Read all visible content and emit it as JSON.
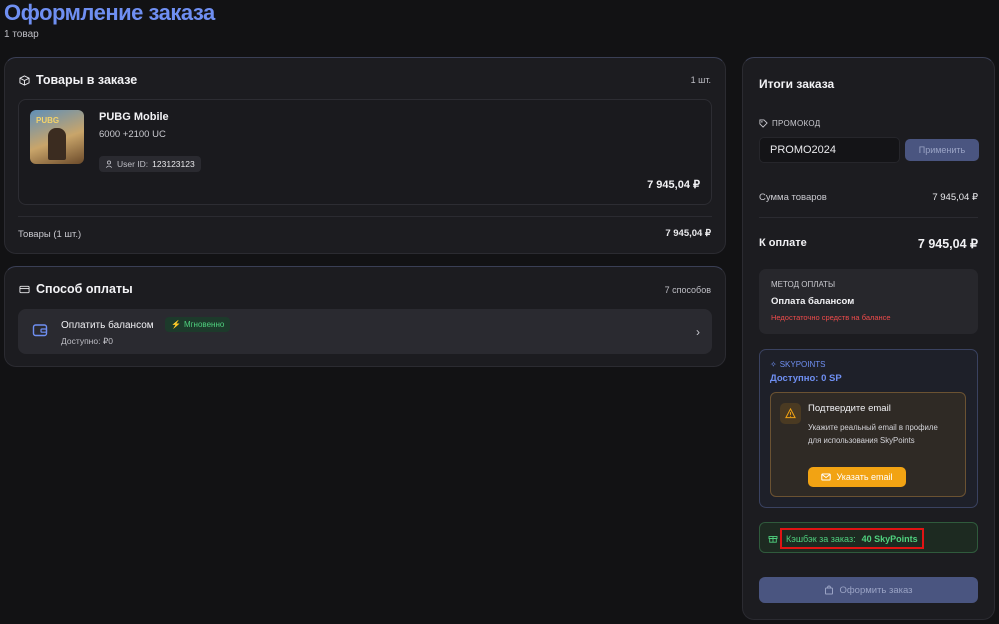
{
  "page": {
    "title": "Оформление заказа",
    "subtitle": "1 товар"
  },
  "items_card": {
    "title": "Товары в заказе",
    "count": "1 шт.",
    "product": {
      "name": "PUBG Mobile",
      "description": "6000 +2100 UC",
      "thumb_label": "PUBG",
      "user_id_label": "User ID:",
      "user_id_value": "123123123",
      "price": "7 945,04 ₽"
    },
    "subtotal_label": "Товары (1 шт.)",
    "subtotal_value": "7 945,04 ₽"
  },
  "payment_card": {
    "title": "Способ оплаты",
    "count": "7 способов",
    "option": {
      "label": "Оплатить балансом",
      "badge": "Мгновенно",
      "available": "Доступно: ₽0"
    }
  },
  "summary": {
    "title": "Итоги заказа",
    "promo_label": "ПРОМОКОД",
    "promo_value": "PROMO2024",
    "promo_button": "Применить",
    "goods_sum_label": "Сумма товаров",
    "goods_sum_value": "7 945,04 ₽",
    "total_label": "К оплате",
    "total_value": "7 945,04 ₽",
    "method": {
      "label": "МЕТОД ОПЛАТЫ",
      "name": "Оплата балансом",
      "warning": "Недостаточно средств на балансе"
    },
    "skypoints": {
      "label": "SKYPOINTS",
      "available": "Доступно: 0 SP",
      "email_title": "Подтвердите email",
      "email_desc": "Укажите реальный email в профиле для использования SkyPoints",
      "email_button": "Указать email"
    },
    "cashback": {
      "label": "Кэшбэк за заказ:",
      "value": "40 SkyPoints"
    },
    "order_button": "Оформить заказ"
  },
  "colors": {
    "accent": "#6f8ff2",
    "success": "#4fd07e",
    "danger": "#ef4b4b",
    "warning": "#f2a313",
    "highlight": "#e01414"
  },
  "icons": [
    "box-icon",
    "card-icon",
    "user-icon",
    "wallet-icon",
    "lightning-icon",
    "chevron-right-icon",
    "tag-icon",
    "sparkle-icon",
    "warning-icon",
    "mail-icon",
    "gift-icon",
    "bag-icon"
  ]
}
